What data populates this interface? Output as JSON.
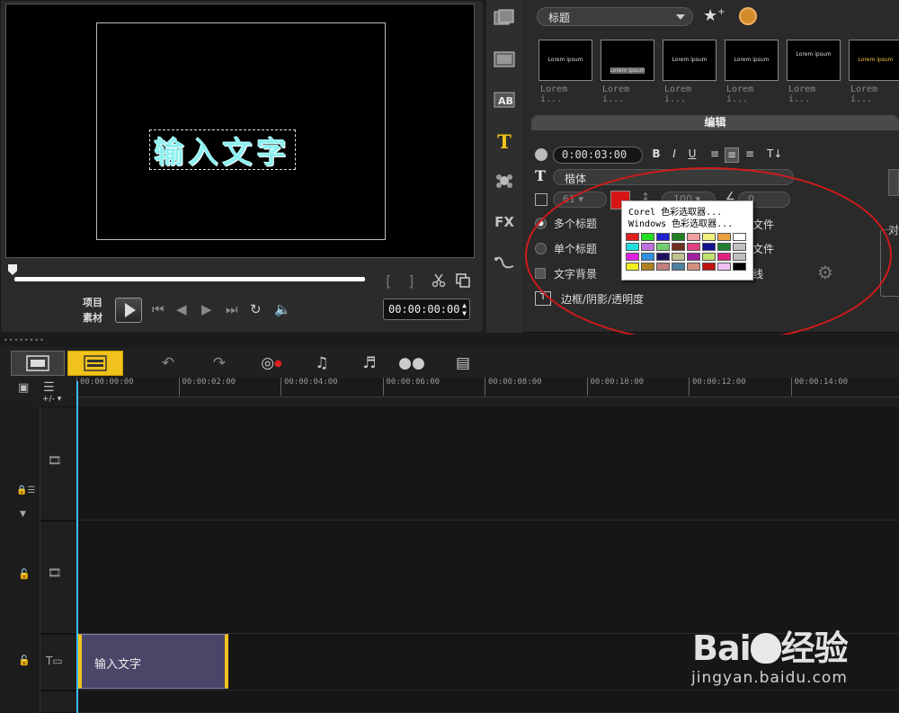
{
  "preview": {
    "title_text": "输入文字",
    "mode_labels": [
      "项目",
      "素材"
    ],
    "timecode": "00:00:00:00"
  },
  "library": {
    "category": "标题",
    "thumbnails": [
      {
        "label": "Lorem i...",
        "text": "Lorem ipsum"
      },
      {
        "label": "Lorem i...",
        "text": "Lorem ipsum"
      },
      {
        "label": "Lorem i...",
        "text": "Lorem ipsum"
      },
      {
        "label": "Lorem i...",
        "text": "Lorem ipsum"
      },
      {
        "label": "Lorem i...",
        "text": "Lorem ipsum"
      },
      {
        "label": "Lorem i...",
        "text": "Lorem ipsum"
      }
    ],
    "edit_header": "编辑"
  },
  "options": {
    "duration": "0:00:03:00",
    "format_buttons": [
      "B",
      "I",
      "U"
    ],
    "font": "楷体",
    "font_size": "61",
    "line_spacing": "100",
    "angle": "0",
    "text_color": "#d61616",
    "multi_title": "多个标题",
    "single_title": "单个标题",
    "text_bg": "文字背景",
    "file_suffix_1": "文件",
    "file_suffix_2": "文件",
    "line_suffix": "线",
    "border_label": "边框/阴影/透明度",
    "right_label": "对"
  },
  "color_popup": {
    "corel_picker": "Corel 色彩选取器...",
    "windows_picker": "Windows 色彩选取器...",
    "swatches": [
      "#e02020",
      "#20e020",
      "#2020d0",
      "#208020",
      "#f0a0a0",
      "#f0f080",
      "#e8a040",
      "#ffffff",
      "#20e0e0",
      "#c070e0",
      "#70d070",
      "#703020",
      "#e04080",
      "#101090",
      "#208030",
      "#c0c0c0",
      "#e020e0",
      "#3090e0",
      "#201060",
      "#c0c090",
      "#a020a0",
      "#c0e070",
      "#e02080",
      "#c0c0c0",
      "#f0f020",
      "#b08020",
      "#c08080",
      "#5080a0",
      "#d09080",
      "#c01010",
      "#f0c0f0",
      "#000000"
    ]
  },
  "timeline": {
    "ruler_ticks": [
      "00:00:00:00",
      "00:00:02:00",
      "00:00:04:00",
      "00:00:06:00",
      "00:00:08:00",
      "00:00:10:00",
      "00:00:12:00",
      "00:00:14:00"
    ],
    "clip_label": "输入文字",
    "add_remove": "+/-"
  },
  "watermark": {
    "logo": "Bai du 经验",
    "url": "jingyan.baidu.com"
  }
}
